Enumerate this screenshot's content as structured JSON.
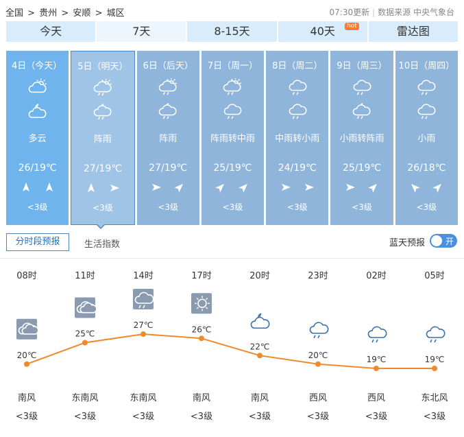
{
  "breadcrumb": {
    "items": [
      "全国",
      "贵州",
      "安顺",
      "城区"
    ],
    "sep": ">"
  },
  "source": {
    "updated": "07:30更新",
    "label": "数据来源 中央气象台"
  },
  "tabs": [
    {
      "label": "今天"
    },
    {
      "label": "7天",
      "active": true
    },
    {
      "label": "8-15天"
    },
    {
      "label": "40天",
      "badge": "hot"
    },
    {
      "label": "雷达图"
    }
  ],
  "days": [
    {
      "date": "4日（今天）",
      "icon_day": "partly-cloudy-day-icon",
      "icon_night": "partly-cloudy-night-icon",
      "desc": "多云",
      "temp": "26/19℃",
      "wind_dirs": [
        "north",
        "north"
      ],
      "wind_level": "<3级"
    },
    {
      "date": "5日（明天）",
      "icon_day": "shower-day-icon",
      "icon_night": "shower-night-icon",
      "desc": "阵雨",
      "temp": "27/19℃",
      "wind_dirs": [
        "north",
        "east"
      ],
      "wind_level": "<3级"
    },
    {
      "date": "6日（后天）",
      "icon_day": "shower-day-icon",
      "icon_night": "shower-night-icon",
      "desc": "阵雨",
      "temp": "27/19℃",
      "wind_dirs": [
        "east",
        "northeast"
      ],
      "wind_level": "<3级"
    },
    {
      "date": "7日（周一）",
      "icon_day": "shower-day-icon",
      "icon_night": "rain-icon",
      "desc": "阵雨转中雨",
      "temp": "25/19℃",
      "wind_dirs": [
        "northeast",
        "northeast"
      ],
      "wind_level": "<3级"
    },
    {
      "date": "8日（周二）",
      "icon_day": "rain-icon",
      "icon_night": "rain-icon",
      "desc": "中雨转小雨",
      "temp": "24/19℃",
      "wind_dirs": [
        "east",
        "east"
      ],
      "wind_level": "<3级"
    },
    {
      "date": "9日（周三）",
      "icon_day": "rain-icon",
      "icon_night": "shower-night-icon",
      "desc": "小雨转阵雨",
      "temp": "25/19℃",
      "wind_dirs": [
        "east",
        "northeast"
      ],
      "wind_level": "<3级"
    },
    {
      "date": "10日（周四）",
      "icon_day": "rain-icon",
      "icon_night": "rain-icon",
      "desc": "小雨",
      "temp": "26/18℃",
      "wind_dirs": [
        "northwest",
        "northeast"
      ],
      "wind_level": "<3级"
    }
  ],
  "subtabs": {
    "hourly": "分时段预报",
    "life": "生活指数"
  },
  "blue_report": {
    "label": "蓝天预报",
    "toggle": "开"
  },
  "hourly": [
    {
      "time": "08时",
      "icon": "cloudy-icon",
      "temp": 20,
      "temp_label": "20℃",
      "wind": "南风",
      "level": "<3级"
    },
    {
      "time": "11时",
      "icon": "cloudy-icon",
      "temp": 25,
      "temp_label": "25℃",
      "wind": "东南风",
      "level": "<3级"
    },
    {
      "time": "14时",
      "icon": "rain-icon",
      "temp": 27,
      "temp_label": "27℃",
      "wind": "东南风",
      "level": "<3级"
    },
    {
      "time": "17时",
      "icon": "sunny-icon",
      "temp": 26,
      "temp_label": "26℃",
      "wind": "南风",
      "level": "<3级"
    },
    {
      "time": "20时",
      "icon": "partly-cloudy-night-icon",
      "temp": 22,
      "temp_label": "22℃",
      "wind": "南风",
      "level": "<3级"
    },
    {
      "time": "23时",
      "icon": "rain-icon",
      "temp": 20,
      "temp_label": "20℃",
      "wind": "西风",
      "level": "<3级"
    },
    {
      "time": "02时",
      "icon": "rain-icon",
      "temp": 19,
      "temp_label": "19℃",
      "wind": "西风",
      "level": "<3级"
    },
    {
      "time": "05时",
      "icon": "rain-icon",
      "temp": 19,
      "temp_label": "19℃",
      "wind": "东北风",
      "level": "<3级"
    }
  ],
  "colors": {
    "line": "#f08a2c",
    "accent": "#4a90e2"
  }
}
